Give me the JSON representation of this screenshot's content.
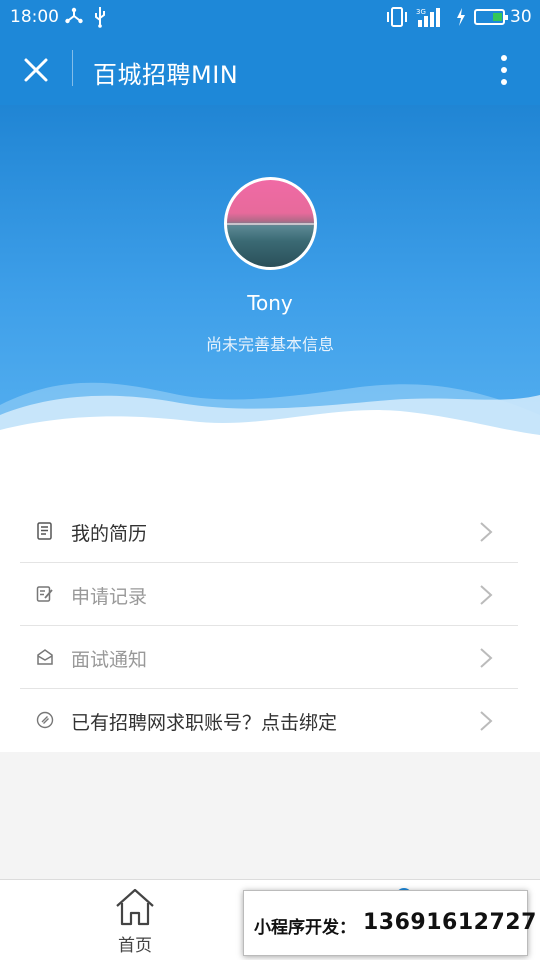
{
  "status_bar": {
    "time": "18:00",
    "network": "3G",
    "battery_level": "30"
  },
  "titlebar": {
    "title": "百城招聘MIN"
  },
  "profile": {
    "username": "Tony",
    "subtitle": "尚未完善基本信息"
  },
  "menu": {
    "items": [
      {
        "label": "我的简历",
        "icon": "resume-icon",
        "muted": false
      },
      {
        "label": "申请记录",
        "icon": "edit-icon",
        "muted": true
      },
      {
        "label": "面试通知",
        "icon": "mail-icon",
        "muted": true
      },
      {
        "label": "已有招聘网求职账号？点击绑定",
        "icon": "link-icon",
        "muted": false
      }
    ]
  },
  "tabbar": {
    "home_label": "首页"
  },
  "promo": {
    "label": "小程序开发：",
    "phone": "13691612727"
  },
  "colors": {
    "primary_blue": "#1e88d8",
    "battery_green": "#34c759"
  }
}
